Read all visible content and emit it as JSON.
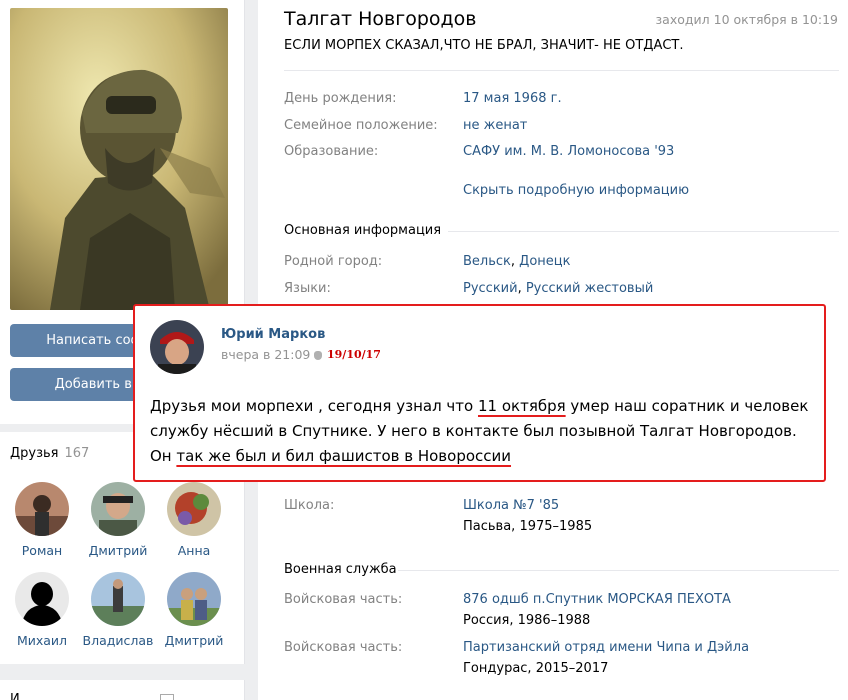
{
  "left": {
    "buttons": {
      "message": "Написать сообщение",
      "add_friend": "Добавить в друзья"
    },
    "friends": {
      "title": "Друзья",
      "count": "167",
      "items": [
        {
          "name": "Роман"
        },
        {
          "name": "Дмитрий"
        },
        {
          "name": "Анна"
        },
        {
          "name": "Михаил"
        },
        {
          "name": "Владислав"
        },
        {
          "name": "Дмитрий"
        }
      ]
    },
    "bottom_card_title": "И"
  },
  "profile": {
    "name": "Талгат Новгородов",
    "last_seen": "заходил 10 октября в 10:19",
    "status": "ЕСЛИ МОРПЕХ СКАЗАЛ,ЧТО НЕ БРАЛ, ЗНАЧИТ- НЕ ОТДАСТ.",
    "details": [
      {
        "label": "День рождения:",
        "value": "17 мая 1968 г."
      },
      {
        "label": "Семейное положение:",
        "value": "не женат"
      },
      {
        "label": "Образование:",
        "value": "САФУ им. М. В. Ломоносова '93"
      }
    ],
    "hide_details_link": "Скрыть подробную информацию",
    "basic_info": {
      "title": "Основная информация",
      "hometown_label": "Родной город:",
      "hometown": [
        "Вельск",
        "Донецк"
      ],
      "languages_label": "Языки:",
      "languages": [
        "Русский",
        "Русский жестовый"
      ]
    },
    "school": {
      "label": "Школа:",
      "name": "Школа №7 '85",
      "place": "Пасьва, 1975–1985"
    },
    "military": {
      "title": "Военная служба",
      "units": [
        {
          "label": "Войсковая часть:",
          "name": "876 одшб п.Спутник МОРСКАЯ ПЕХОТА",
          "place": "Россия, 1986–1988"
        },
        {
          "label": "Войсковая часть:",
          "name": "Партизанский отряд имени Чипа и Дэйла",
          "place": "Гондурас, 2015–2017"
        }
      ]
    }
  },
  "post": {
    "author": "Юрий Марков",
    "time": "вчера в 21:09",
    "date_annotation": "19/10/17",
    "text_parts": {
      "p1": "Друзья мои морпехи , сегодня узнал что ",
      "u1": "11 октября",
      "p2": " умер наш соратник и человек службу нёсший в Спутнике. У него в контакте был позывной Талгат Новгородов. Он ",
      "u2": "так же был и бил фашистов в Новороссии"
    }
  },
  "colors": {
    "link": "#2a5885",
    "button": "#5e81a8",
    "highlight_border": "#e41d1d",
    "date_annotation": "#cc0000"
  }
}
